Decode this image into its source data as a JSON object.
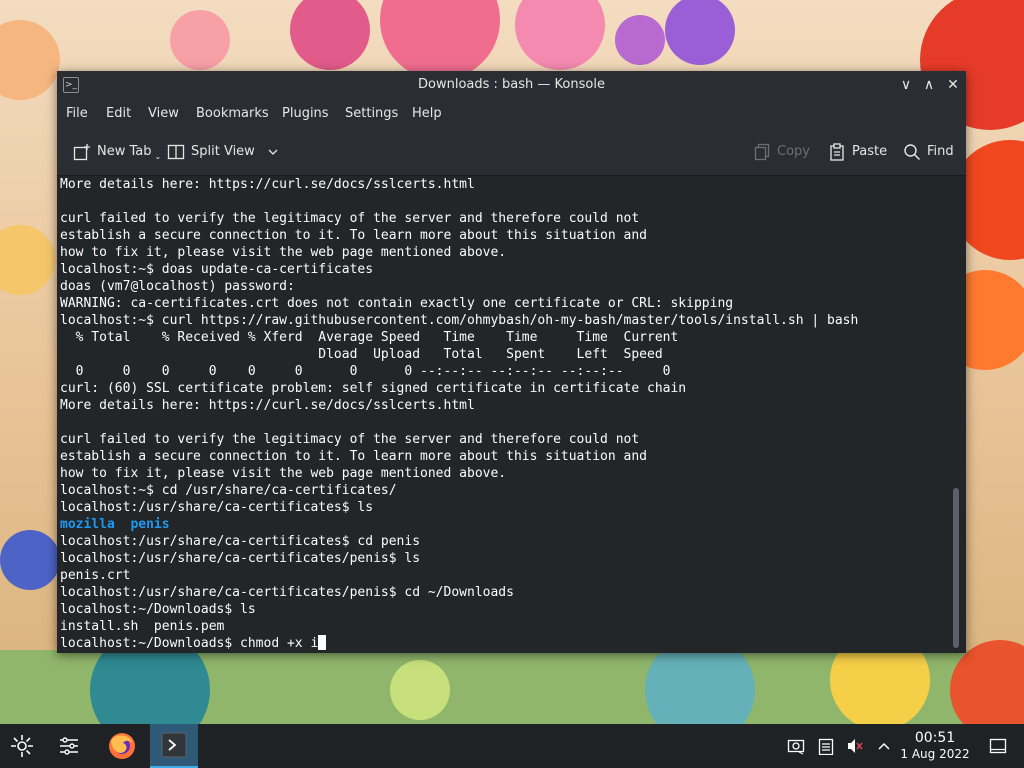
{
  "window": {
    "title": "Downloads : bash — Konsole",
    "controls": {
      "minimize": "∨",
      "maximize": "∧",
      "close": "✕"
    }
  },
  "menu": [
    "File",
    "Edit",
    "View",
    "Bookmarks",
    "Plugins",
    "Settings",
    "Help"
  ],
  "toolbar": {
    "new_tab": "New Tab",
    "split_view": "Split View",
    "copy": "Copy",
    "paste": "Paste",
    "find": "Find"
  },
  "terminal": {
    "lines": [
      "More details here: https://curl.se/docs/sslcerts.html",
      "",
      "curl failed to verify the legitimacy of the server and therefore could not",
      "establish a secure connection to it. To learn more about this situation and",
      "how to fix it, please visit the web page mentioned above.",
      "localhost:~$ doas update-ca-certificates",
      "doas (vm7@localhost) password:",
      "WARNING: ca-certificates.crt does not contain exactly one certificate or CRL: skipping",
      "localhost:~$ curl https://raw.githubusercontent.com/ohmybash/oh-my-bash/master/tools/install.sh | bash",
      "  % Total    % Received % Xferd  Average Speed   Time    Time     Time  Current",
      "                                 Dload  Upload   Total   Spent    Left  Speed",
      "  0     0    0     0    0     0      0      0 --:--:-- --:--:-- --:--:--     0",
      "curl: (60) SSL certificate problem: self signed certificate in certificate chain",
      "More details here: https://curl.se/docs/sslcerts.html",
      "",
      "curl failed to verify the legitimacy of the server and therefore could not",
      "establish a secure connection to it. To learn more about this situation and",
      "how to fix it, please visit the web page mentioned above.",
      "localhost:~$ cd /usr/share/ca-certificates/",
      "localhost:/usr/share/ca-certificates$ ls",
      "mozilla  penis",
      "localhost:/usr/share/ca-certificates$ cd penis",
      "localhost:/usr/share/ca-certificates/penis$ ls",
      "penis.crt",
      "localhost:/usr/share/ca-certificates/penis$ cd ~/Downloads",
      "localhost:~/Downloads$ ls",
      "install.sh  penis.pem"
    ],
    "dir_listing_line_index": 20,
    "prompt_line": "localhost:~/Downloads$ chmod +x i",
    "scroll_position": 1.0,
    "dir_color": "#1d99f3"
  },
  "taskbar": {
    "launcher_icon": "kde-launcher-icon",
    "pager_icon": "overview-icon",
    "apps": [
      {
        "name": "firefox-icon"
      },
      {
        "name": "konsole-icon",
        "active": true
      }
    ],
    "tray": [
      "screenshot-icon",
      "clipboard-icon",
      "volume-muted-icon",
      "tray-expand-icon"
    ],
    "clock": {
      "time": "00:51",
      "date": "1 Aug 2022"
    },
    "show_desktop_icon": "show-desktop-icon"
  },
  "colors": {
    "window_bg": "#232629",
    "chrome_bg": "#2a2e32",
    "accent": "#3daee9",
    "taskbar_bg": "#1f2225"
  }
}
